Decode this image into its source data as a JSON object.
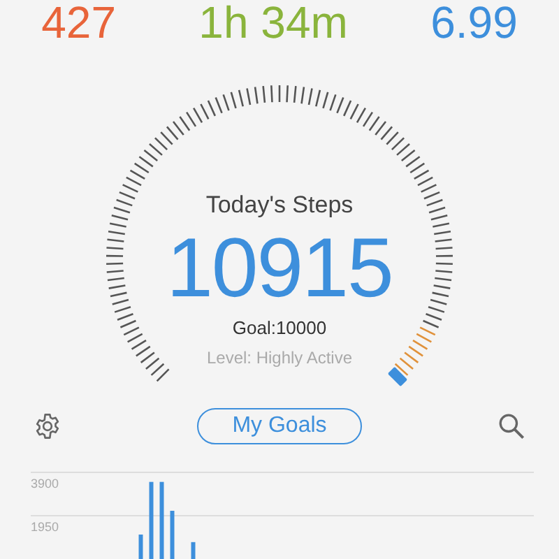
{
  "stats": [
    {
      "value": "427",
      "color": "#e8643a"
    },
    {
      "value": "1h 34m",
      "color": "#8ab43c"
    },
    {
      "value": "6.99",
      "color": "#3d8fdc"
    }
  ],
  "gauge": {
    "title": "Today's Steps",
    "steps": "10915",
    "goal": "Goal:10000",
    "level_text": "Level: Highly Active"
  },
  "actions": {
    "button": "My Goals"
  },
  "chart_data": {
    "type": "bar",
    "ylim": [
      0,
      3900
    ],
    "yticks": [
      1950,
      3900
    ],
    "series": [
      {
        "color": "#3d8fdc",
        "values": [
          null,
          null,
          null,
          null,
          null,
          null,
          null,
          null,
          null,
          null,
          1100,
          3470,
          3470,
          2170,
          null,
          760,
          null,
          null,
          null,
          null,
          null,
          null,
          null,
          null,
          null,
          null,
          null,
          null,
          null,
          null,
          null,
          null,
          null,
          null,
          null,
          null,
          null,
          null,
          null,
          null,
          null,
          null,
          null,
          null,
          null,
          null,
          null,
          null
        ]
      }
    ]
  }
}
